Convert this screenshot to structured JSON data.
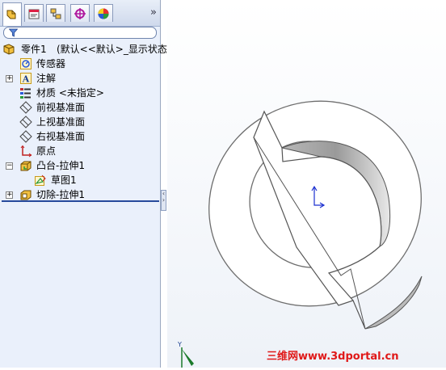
{
  "tree": {
    "root_part": "零件1",
    "root_config": "(默认<<默认>_显示状态",
    "sensors": "传感器",
    "annotations": "注解",
    "material": "材质 <未指定>",
    "front_plane": "前视基准面",
    "top_plane": "上视基准面",
    "right_plane": "右视基准面",
    "origin": "原点",
    "boss_extrude": "凸台-拉伸1",
    "sketch": "草图1",
    "cut_extrude": "切除-拉伸1"
  },
  "icons": {
    "tab1": "feature-manager-icon",
    "tab2": "property-manager-icon",
    "tab3": "configuration-manager-icon",
    "tab4": "dimxpert-manager-icon",
    "tab5": "display-manager-icon",
    "more": "chevron-double-right-icon",
    "filter": "filter-icon"
  },
  "more_label": "»",
  "axis": {
    "y_label": "Y"
  },
  "watermark": "三维网www.3dportal.cn",
  "colors": {
    "watermark": "#e01818",
    "rollback_bar": "#274a9c",
    "triad": "#1b7a2a",
    "origin": "#1a2fd0"
  }
}
